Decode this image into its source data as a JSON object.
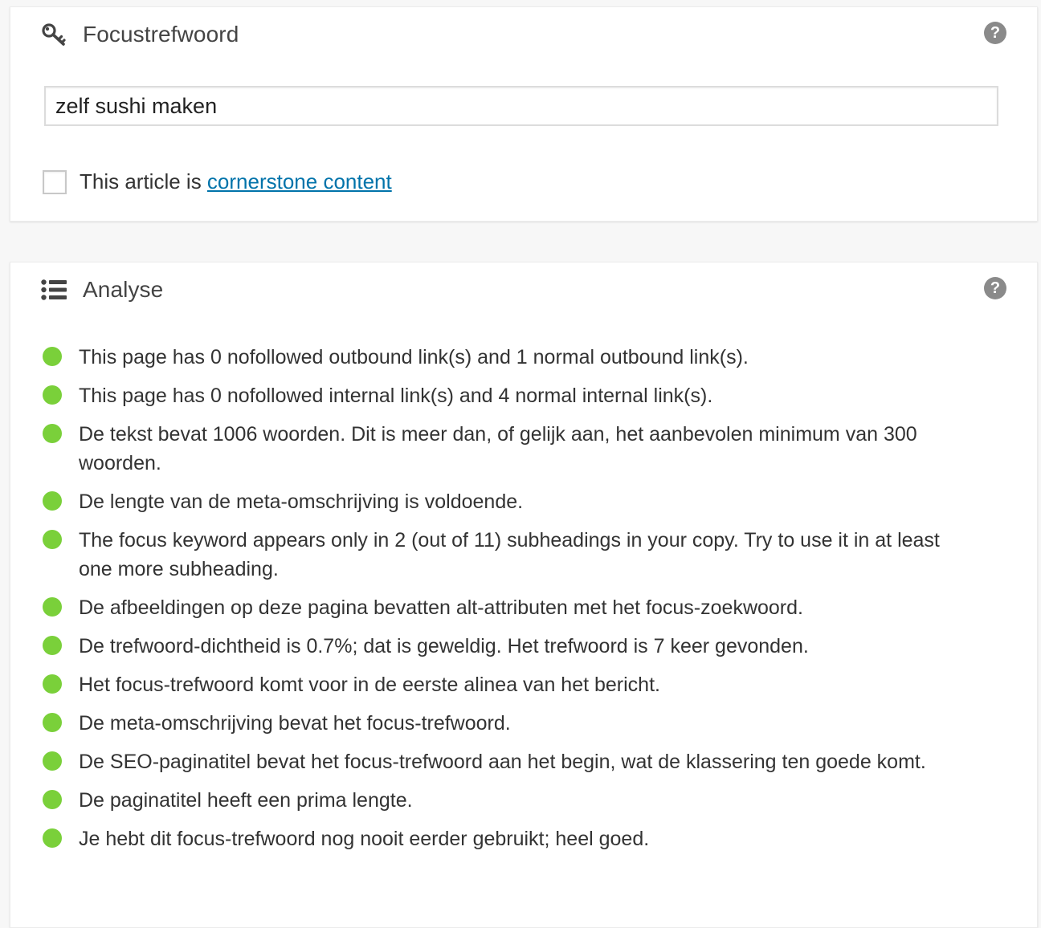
{
  "colors": {
    "good_dot": "#7ad03a",
    "link": "#0073aa",
    "help_icon": "#8a8a8a"
  },
  "keyword_panel": {
    "icon": "key-icon",
    "title": "Focustrefwoord",
    "help_icon": "help-icon",
    "help_glyph": "?",
    "input_value": "zelf sushi maken",
    "cornerstone": {
      "checked": false,
      "label_prefix": "This article is ",
      "link_text": "cornerstone content"
    }
  },
  "analysis_panel": {
    "icon": "list-icon",
    "title": "Analyse",
    "help_icon": "help-icon",
    "help_glyph": "?",
    "results": [
      {
        "status": "good",
        "text": "This page has 0 nofollowed outbound link(s) and 1 normal outbound link(s)."
      },
      {
        "status": "good",
        "text": "This page has 0 nofollowed internal link(s) and 4 normal internal link(s)."
      },
      {
        "status": "good",
        "text": "De tekst bevat 1006 woorden. Dit is meer dan, of gelijk aan, het aanbevolen minimum van 300 woorden."
      },
      {
        "status": "good",
        "text": "De lengte van de meta-omschrijving is voldoende."
      },
      {
        "status": "good",
        "text": "The focus keyword appears only in 2 (out of 11) subheadings in your copy. Try to use it in at least one more subheading."
      },
      {
        "status": "good",
        "text": "De afbeeldingen op deze pagina bevatten alt-attributen met het focus-zoekwoord."
      },
      {
        "status": "good",
        "text": "De trefwoord-dichtheid is 0.7%; dat is geweldig. Het trefwoord is 7 keer gevonden."
      },
      {
        "status": "good",
        "text": "Het focus-trefwoord komt voor in de eerste alinea van het bericht."
      },
      {
        "status": "good",
        "text": "De meta-omschrijving bevat het focus-trefwoord."
      },
      {
        "status": "good",
        "text": "De SEO-paginatitel bevat het focus-trefwoord aan het begin, wat de klassering ten goede komt."
      },
      {
        "status": "good",
        "text": "De paginatitel heeft een prima lengte."
      },
      {
        "status": "good",
        "text": "Je hebt dit focus-trefwoord nog nooit eerder gebruikt; heel goed."
      }
    ]
  }
}
